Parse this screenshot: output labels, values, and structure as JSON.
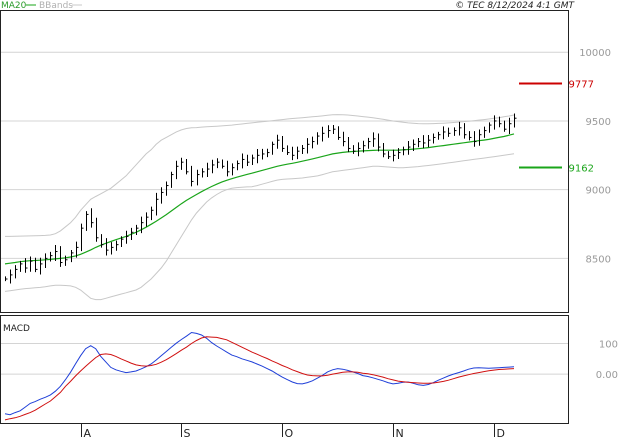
{
  "legend": {
    "ma_label": "MA20",
    "bb_label": "BBands"
  },
  "copyright": "© TEC 8/12/2024 4:1 GMT",
  "colors": {
    "price": "#000000",
    "ma20": "#1aa51a",
    "bbands": "#c8c8c8",
    "macd": "#1f3fd8",
    "signal": "#d01010",
    "resistance": "#cc0000",
    "support": "#1aa51a",
    "grid": "#d4d4d4"
  },
  "chart_data": [
    {
      "type": "ohlc",
      "ylim": [
        8110,
        10300
      ],
      "y_ticks": [
        8500,
        9000,
        9500,
        10000
      ],
      "y_tick_labels": [
        "8500",
        "9000",
        "9500",
        "10000"
      ],
      "x_labels": [
        {
          "label": "A",
          "index": 15
        },
        {
          "label": "S",
          "index": 35
        },
        {
          "label": "O",
          "index": 55
        },
        {
          "label": "N",
          "index": 77
        },
        {
          "label": "D",
          "index": 97
        }
      ],
      "n_bars": 102,
      "levels": [
        {
          "name": "resistance",
          "value": 9777,
          "label": "9777"
        },
        {
          "name": "support",
          "value": 9162,
          "label": "9162"
        }
      ],
      "series": {
        "close": [
          8350,
          8380,
          8420,
          8460,
          8430,
          8480,
          8420,
          8460,
          8500,
          8520,
          8550,
          8470,
          8490,
          8540,
          8580,
          8720,
          8820,
          8760,
          8650,
          8600,
          8560,
          8580,
          8600,
          8640,
          8660,
          8690,
          8720,
          8760,
          8800,
          8850,
          8930,
          8980,
          9030,
          9110,
          9170,
          9200,
          9130,
          9060,
          9110,
          9130,
          9150,
          9180,
          9200,
          9170,
          9130,
          9160,
          9190,
          9220,
          9200,
          9230,
          9250,
          9260,
          9270,
          9330,
          9360,
          9300,
          9270,
          9250,
          9280,
          9300,
          9330,
          9350,
          9390,
          9410,
          9430,
          9440,
          9380,
          9350,
          9300,
          9280,
          9300,
          9320,
          9350,
          9370,
          9310,
          9260,
          9240,
          9250,
          9270,
          9290,
          9310,
          9330,
          9350,
          9340,
          9360,
          9380,
          9400,
          9420,
          9410,
          9430,
          9450,
          9400,
          9380,
          9350,
          9400,
          9430,
          9470,
          9500,
          9480,
          9440,
          9480,
          9520
        ],
        "ma20": [
          8460,
          8465,
          8470,
          8476,
          8480,
          8483,
          8485,
          8487,
          8490,
          8493,
          8496,
          8500,
          8504,
          8510,
          8518,
          8530,
          8545,
          8562,
          8580,
          8596,
          8610,
          8623,
          8636,
          8648,
          8660,
          8675,
          8690,
          8708,
          8727,
          8748,
          8770,
          8794,
          8819,
          8845,
          8871,
          8898,
          8922,
          8944,
          8965,
          8985,
          9005,
          9023,
          9040,
          9055,
          9068,
          9080,
          9091,
          9101,
          9111,
          9120,
          9130,
          9140,
          9150,
          9160,
          9170,
          9178,
          9185,
          9192,
          9199,
          9207,
          9215,
          9224,
          9233,
          9242,
          9251,
          9260,
          9266,
          9271,
          9275,
          9278,
          9280,
          9282,
          9284,
          9286,
          9287,
          9287,
          9287,
          9287,
          9288,
          9290,
          9292,
          9295,
          9298,
          9302,
          9306,
          9311,
          9316,
          9321,
          9326,
          9331,
          9336,
          9341,
          9346,
          9351,
          9356,
          9361,
          9366,
          9373,
          9380,
          9387,
          9396,
          9406
        ],
        "bb_upper": [
          8660,
          8660,
          8661,
          8662,
          8663,
          8664,
          8665,
          8666,
          8667,
          8670,
          8680,
          8700,
          8730,
          8760,
          8800,
          8850,
          8890,
          8930,
          8950,
          8970,
          8990,
          9010,
          9040,
          9070,
          9100,
          9140,
          9180,
          9220,
          9260,
          9290,
          9330,
          9360,
          9380,
          9400,
          9420,
          9435,
          9445,
          9450,
          9452,
          9455,
          9458,
          9460,
          9462,
          9464,
          9467,
          9470,
          9474,
          9478,
          9482,
          9486,
          9490,
          9494,
          9498,
          9502,
          9506,
          9510,
          9514,
          9518,
          9521,
          9524,
          9527,
          9530,
          9533,
          9537,
          9541,
          9545,
          9546,
          9545,
          9543,
          9540,
          9536,
          9532,
          9528,
          9523,
          9518,
          9512,
          9506,
          9500,
          9495,
          9490,
          9486,
          9483,
          9481,
          9480,
          9480,
          9481,
          9482,
          9484,
          9486,
          9489,
          9492,
          9495,
          9498,
          9502,
          9506,
          9510,
          9514,
          9519,
          9524,
          9530,
          9536,
          9543
        ],
        "bb_lower": [
          8260,
          8265,
          8270,
          8275,
          8280,
          8283,
          8286,
          8289,
          8293,
          8300,
          8305,
          8305,
          8303,
          8300,
          8290,
          8270,
          8240,
          8210,
          8200,
          8200,
          8210,
          8220,
          8230,
          8240,
          8250,
          8260,
          8270,
          8290,
          8320,
          8350,
          8390,
          8430,
          8480,
          8540,
          8600,
          8660,
          8720,
          8780,
          8830,
          8870,
          8910,
          8940,
          8965,
          8985,
          9000,
          9010,
          9015,
          9018,
          9020,
          9022,
          9030,
          9040,
          9050,
          9060,
          9070,
          9075,
          9078,
          9080,
          9082,
          9085,
          9090,
          9095,
          9100,
          9110,
          9120,
          9130,
          9135,
          9140,
          9145,
          9150,
          9155,
          9160,
          9165,
          9170,
          9170,
          9168,
          9165,
          9162,
          9160,
          9160,
          9162,
          9165,
          9168,
          9172,
          9176,
          9180,
          9185,
          9190,
          9195,
          9200,
          9205,
          9210,
          9215,
          9220,
          9225,
          9230,
          9235,
          9240,
          9245,
          9250,
          9256,
          9262
        ]
      }
    },
    {
      "type": "line",
      "title": "MACD",
      "ylim": [
        -160,
        190
      ],
      "y_ticks": [
        0,
        100
      ],
      "y_tick_labels": [
        "0.00",
        "100"
      ],
      "series": [
        {
          "name": "MACD",
          "values": [
            -130,
            -133,
            -126,
            -120,
            -108,
            -96,
            -90,
            -82,
            -76,
            -68,
            -56,
            -40,
            -18,
            6,
            34,
            60,
            83,
            93,
            83,
            58,
            40,
            22,
            14,
            9,
            5,
            7,
            10,
            17,
            24,
            33,
            46,
            60,
            74,
            88,
            101,
            113,
            124,
            136,
            133,
            128,
            117,
            103,
            92,
            82,
            72,
            62,
            57,
            50,
            45,
            40,
            33,
            26,
            18,
            10,
            0,
            -10,
            -18,
            -26,
            -31,
            -32,
            -28,
            -22,
            -13,
            -4,
            7,
            14,
            18,
            16,
            12,
            7,
            2,
            -5,
            -8,
            -12,
            -17,
            -22,
            -28,
            -32,
            -30,
            -27,
            -26,
            -30,
            -35,
            -37,
            -34,
            -28,
            -20,
            -13,
            -6,
            0,
            5,
            10,
            16,
            20,
            21,
            20,
            19,
            20,
            21,
            22,
            23,
            24
          ]
        },
        {
          "name": "Signal",
          "values": [
            -150,
            -146,
            -143,
            -138,
            -132,
            -126,
            -118,
            -108,
            -98,
            -88,
            -74,
            -60,
            -40,
            -24,
            -6,
            10,
            25,
            40,
            54,
            64,
            66,
            64,
            58,
            50,
            43,
            36,
            30,
            27,
            26,
            28,
            32,
            39,
            47,
            57,
            67,
            78,
            88,
            100,
            110,
            118,
            122,
            121,
            120,
            116,
            112,
            104,
            96,
            88,
            80,
            72,
            65,
            58,
            51,
            43,
            36,
            28,
            22,
            14,
            8,
            2,
            -3,
            -5,
            -6,
            -6,
            -4,
            0,
            3,
            6,
            7,
            7,
            6,
            3,
            1,
            -2,
            -6,
            -10,
            -15,
            -19,
            -23,
            -25,
            -27,
            -28,
            -29,
            -30,
            -30,
            -29,
            -27,
            -24,
            -20,
            -15,
            -10,
            -6,
            -2,
            2,
            5,
            8,
            11,
            13,
            15,
            16,
            17,
            18
          ]
        }
      ]
    }
  ]
}
